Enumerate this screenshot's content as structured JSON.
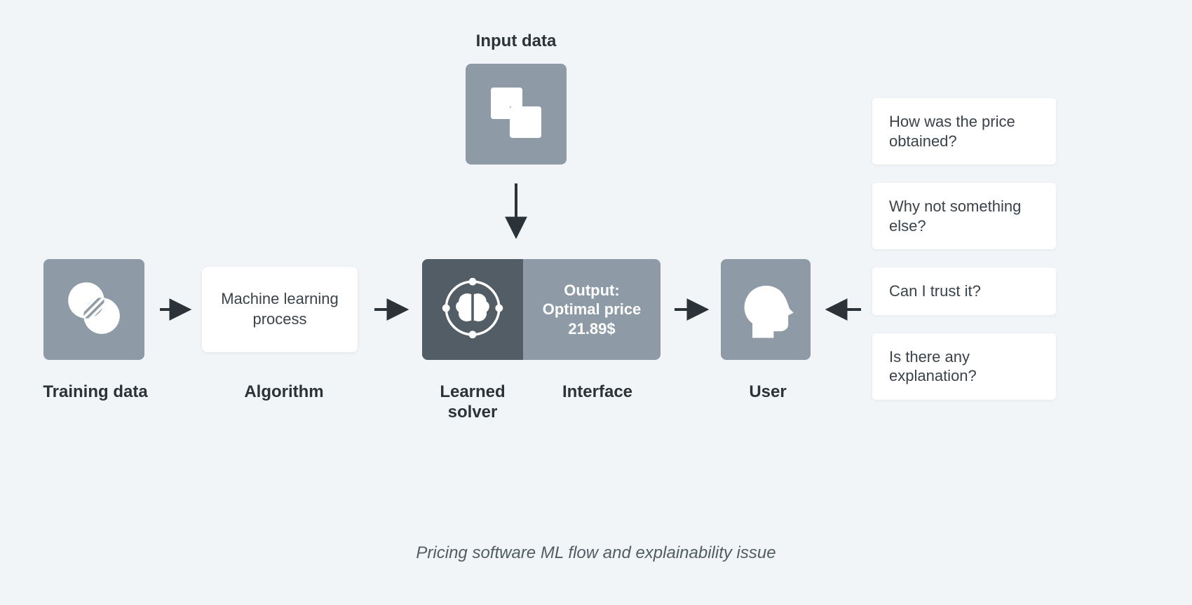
{
  "input": {
    "label": "Input data"
  },
  "training": {
    "label": "Training data"
  },
  "algorithm": {
    "label": "Algorithm",
    "card_text_line1": "Machine learning",
    "card_text_line2": "process"
  },
  "solver": {
    "label": "Learned solver"
  },
  "interface": {
    "label": "Interface",
    "line1": "Output:",
    "line2": "Optimal price",
    "line3": "21.89$"
  },
  "user": {
    "label": "User"
  },
  "questions": [
    "How was the price obtained?",
    "Why not something else?",
    "Can I trust it?",
    "Is there any explanation?"
  ],
  "caption": "Pricing software ML flow and explainability issue"
}
